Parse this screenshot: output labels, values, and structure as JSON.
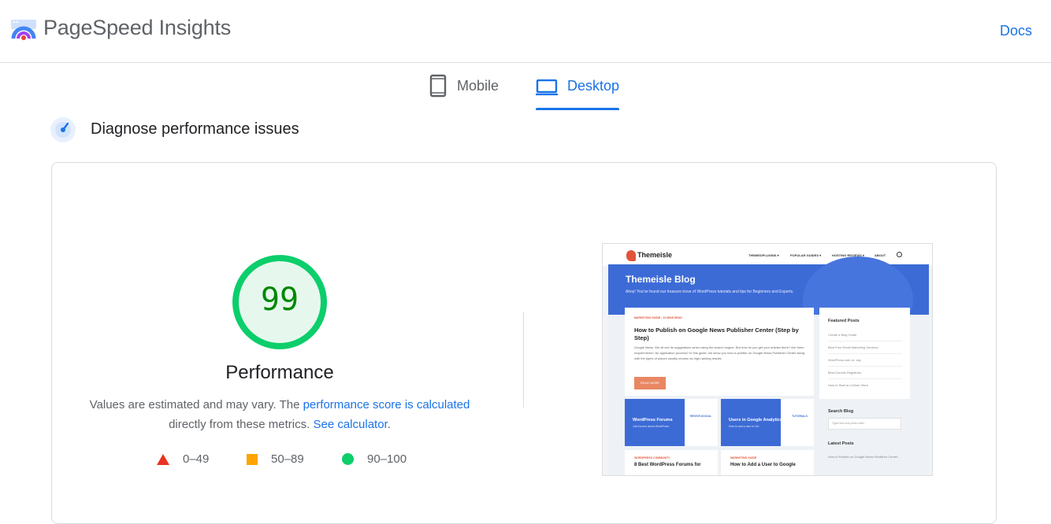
{
  "header": {
    "app_title": "PageSpeed Insights",
    "docs_label": "Docs",
    "logo_icon": "pagespeed-logo-icon"
  },
  "tabs": [
    {
      "label": "Mobile",
      "icon": "phone-icon",
      "selected": false
    },
    {
      "label": "Desktop",
      "icon": "laptop-icon",
      "selected": true
    }
  ],
  "section": {
    "title": "Diagnose performance issues",
    "icon": "compass-gauge-icon"
  },
  "performance": {
    "score": "99",
    "score_value": 99,
    "title": "Performance",
    "desc_prefix": "Values are estimated and may vary. The ",
    "score_link": "performance score is calculated",
    "desc_mid": "directly from these metrics. ",
    "calc_link": "See calculator",
    "desc_suffix": ".",
    "legend": [
      {
        "range": "0–49",
        "shape": "triangle",
        "color": "#eb3223"
      },
      {
        "range": "50–89",
        "shape": "square",
        "color": "#ffa400"
      },
      {
        "range": "90–100",
        "shape": "circle",
        "color": "#0cce6b"
      }
    ]
  },
  "colors": {
    "accent": "#1a73e8",
    "good": "#0cce6b",
    "good_text": "#008800",
    "gauge_fill": "#e6f8ee"
  },
  "screenshot": {
    "logo": "Themeisle",
    "menu": [
      "THEMES/PLUGINS ▾",
      "POPULAR GUIDES ▾",
      "HOSTING REVIEWS ▾",
      "ABOUT"
    ],
    "blog_title": "Themeisle Blog",
    "blog_subtitle": "Ahoy! You've found our treasure trove of WordPress tutorials and tips for Beginners and Experts.",
    "post_meta": "MARKETING GUIDE  •  13 MINS READ",
    "post_title": "How to Publish on Google News Publisher Center (Step by Step)",
    "post_excerpt": "Google News. We all see its suggestions when using the search engine. But how do you get your articles there? Are there requirements? An application process? In this guide, we show you how to publish on Google News Publisher Center along with the types of places usually chosen as high-ranking results.",
    "read_more": "READ MORE",
    "featured_heading": "Featured Posts",
    "featured_links": [
      "Create a Blog Guide",
      "Best Free Email Marketing Services",
      "WordPress.com vs .org",
      "Best Domain Registrars",
      "How to Start an Online Store"
    ],
    "card1_title": "WordPress Forums",
    "card1_sub": "Join forums about WordPress",
    "card1_logo": "REVIVE.SOCIAL",
    "card2_title": "Users in Google Analytics",
    "card2_sub": "How to add a user to GA",
    "card2_logo": "TUTORIALS",
    "lower1_meta": "WORDPRESS COMMUNITY",
    "lower1_title": "8 Best WordPress Forums for",
    "lower2_meta": "MARKETING GUIDE",
    "lower2_title": "How to Add a User to Google",
    "search_heading": "Search Blog",
    "search_placeholder": "Type here and press enter",
    "latest_heading": "Latest Posts",
    "latest_link": "How to Publish on Google News Publisher Center..."
  }
}
